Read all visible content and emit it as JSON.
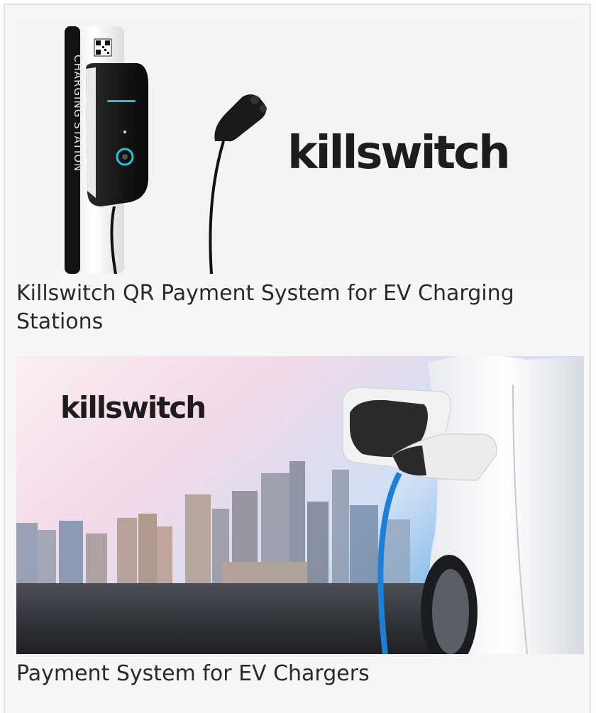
{
  "products": [
    {
      "title": "Killswitch QR Payment System for EV Charging Stations",
      "image": {
        "logo_text": "killswitch",
        "station_label": "CHARGING STATION"
      }
    },
    {
      "title": "Payment System for EV Chargers",
      "image": {
        "logo_text": "killswitch"
      }
    }
  ],
  "colors": {
    "panel_bg": "#f6f6f6",
    "text": "#2a2a2a",
    "accent_teal": "#22c4d8",
    "cable_blue": "#1e7fd6"
  }
}
